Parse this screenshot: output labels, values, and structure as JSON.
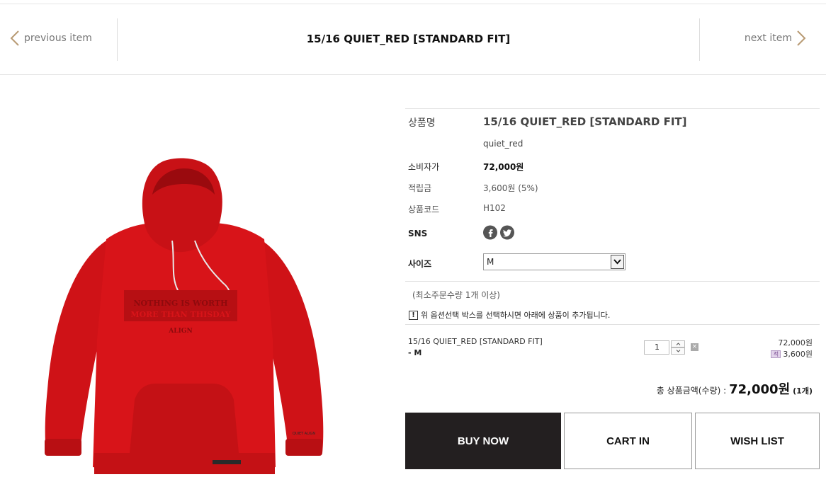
{
  "nav": {
    "previous_label": "previous item",
    "next_label": "next item",
    "title": "15/16 QUIET_RED [STANDARD FIT]"
  },
  "product": {
    "name_label": "상품명",
    "name": "15/16 QUIET_RED [STANDARD FIT]",
    "subname": "quiet_red",
    "consumer_price_label": "소비자가",
    "consumer_price": "72,000원",
    "points_label": "적립금",
    "points": "3,600원 (5%)",
    "code_label": "상품코드",
    "code": "H102",
    "sns_label": "SNS",
    "size_label": "사이즈",
    "size_selected": "M",
    "min_order_note": "(최소주문수량 1개 이상)",
    "option_notice": "위 옵션선택 박스를 선택하시면 아래에 상품이 추가됩니다.",
    "image_print": {
      "line1": "NOTHING IS WORTH",
      "line2": "MORE THAN THISDAY",
      "brand": "ALIGN",
      "cuff": "QUIET ALIGN"
    }
  },
  "selected_option": {
    "name": "15/16 QUIET_RED [STANDARD FIT]",
    "option": "- M",
    "quantity": "1",
    "price": "72,000원",
    "points": "3,600원",
    "points_badge": "적"
  },
  "total": {
    "label": "총 상품금액(수량) :",
    "amount": "72,000원",
    "count": "(1개)"
  },
  "buttons": {
    "buy_now": "BUY NOW",
    "cart_in": "CART IN",
    "wish_list": "WISH LIST"
  },
  "colors": {
    "hoodie_red": "#d81419",
    "nav_arrow": "#b89a73",
    "buy_button_bg": "#231f20"
  },
  "icons": [
    "chevron-left-icon",
    "chevron-right-icon",
    "facebook-icon",
    "twitter-icon",
    "chevron-down-icon",
    "alert-icon",
    "points-icon",
    "close-icon"
  ]
}
